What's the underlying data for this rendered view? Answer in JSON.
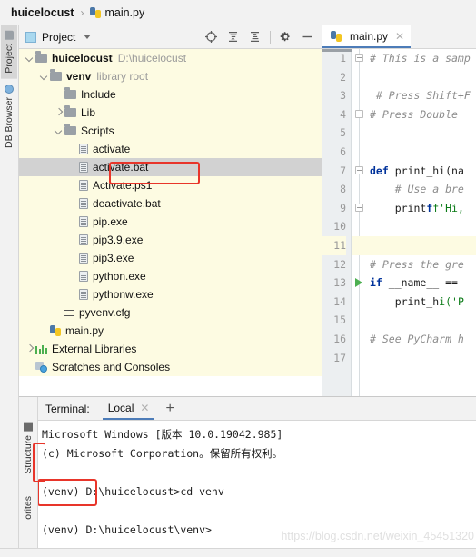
{
  "breadcrumb": {
    "project": "huicelocust",
    "separator": "›",
    "file": "main.py",
    "file_icon": "python-file-icon"
  },
  "left_strip": {
    "tabs": [
      {
        "label": "Project",
        "icon": "folder-icon",
        "active": true
      },
      {
        "label": "DB Browser",
        "icon": "database-icon",
        "active": false
      }
    ]
  },
  "bottom_strip": {
    "tabs": [
      {
        "label": "Structure",
        "icon": "structure-icon"
      },
      {
        "label": "orites",
        "icon": "favorites-icon"
      }
    ]
  },
  "project_panel": {
    "title": "Project",
    "title_icon": "project-panel-icon",
    "dropdown_icon": "chevron-down-icon",
    "toolbar": [
      {
        "name": "select-opened-file-icon"
      },
      {
        "name": "expand-all-icon"
      },
      {
        "name": "collapse-all-icon"
      },
      {
        "name": "settings-gear-icon"
      },
      {
        "name": "hide-panel-icon"
      }
    ],
    "tree": [
      {
        "label": "huicelocust",
        "suffix": "D:\\huicelocust",
        "indent": 0,
        "arrow": "down",
        "icon": "folder-icon",
        "bold": true,
        "selected": false
      },
      {
        "label": "venv",
        "suffix": "library root",
        "indent": 1,
        "arrow": "down",
        "icon": "folder-icon",
        "bold": true,
        "selected": false
      },
      {
        "label": "Include",
        "suffix": "",
        "indent": 2,
        "arrow": "none",
        "icon": "folder-icon",
        "bold": false,
        "selected": false
      },
      {
        "label": "Lib",
        "suffix": "",
        "indent": 2,
        "arrow": "right",
        "icon": "folder-icon",
        "bold": false,
        "selected": false
      },
      {
        "label": "Scripts",
        "suffix": "",
        "indent": 2,
        "arrow": "down",
        "icon": "folder-icon",
        "bold": false,
        "selected": false
      },
      {
        "label": "activate",
        "suffix": "",
        "indent": 3,
        "arrow": "none",
        "icon": "file-icon",
        "bold": false,
        "selected": false
      },
      {
        "label": "activate.bat",
        "suffix": "",
        "indent": 3,
        "arrow": "none",
        "icon": "file-icon",
        "bold": false,
        "selected": true
      },
      {
        "label": "Activate.ps1",
        "suffix": "",
        "indent": 3,
        "arrow": "none",
        "icon": "file-icon",
        "bold": false,
        "selected": false
      },
      {
        "label": "deactivate.bat",
        "suffix": "",
        "indent": 3,
        "arrow": "none",
        "icon": "file-icon",
        "bold": false,
        "selected": false
      },
      {
        "label": "pip.exe",
        "suffix": "",
        "indent": 3,
        "arrow": "none",
        "icon": "file-icon",
        "bold": false,
        "selected": false
      },
      {
        "label": "pip3.9.exe",
        "suffix": "",
        "indent": 3,
        "arrow": "none",
        "icon": "file-icon",
        "bold": false,
        "selected": false
      },
      {
        "label": "pip3.exe",
        "suffix": "",
        "indent": 3,
        "arrow": "none",
        "icon": "file-icon",
        "bold": false,
        "selected": false
      },
      {
        "label": "python.exe",
        "suffix": "",
        "indent": 3,
        "arrow": "none",
        "icon": "file-icon",
        "bold": false,
        "selected": false
      },
      {
        "label": "pythonw.exe",
        "suffix": "",
        "indent": 3,
        "arrow": "none",
        "icon": "file-icon",
        "bold": false,
        "selected": false
      },
      {
        "label": "pyvenv.cfg",
        "suffix": "",
        "indent": 2,
        "arrow": "none",
        "icon": "config-file-icon",
        "bold": false,
        "selected": false
      },
      {
        "label": "main.py",
        "suffix": "",
        "indent": 1,
        "arrow": "none",
        "icon": "python-file-icon",
        "bold": false,
        "selected": false
      },
      {
        "label": "External Libraries",
        "suffix": "",
        "indent": 0,
        "arrow": "right",
        "icon": "libraries-icon",
        "bold": false,
        "selected": false
      },
      {
        "label": "Scratches and Consoles",
        "suffix": "",
        "indent": 0,
        "arrow": "none",
        "icon": "scratches-icon",
        "bold": false,
        "selected": false
      }
    ]
  },
  "editor": {
    "tab": {
      "label": "main.py",
      "icon": "python-file-icon",
      "close_icon": "close-icon"
    },
    "lines": [
      {
        "n": "1",
        "text": "# This is a samp",
        "style": "cmt",
        "fold": "minus",
        "run": false,
        "hl": false
      },
      {
        "n": "2",
        "text": "",
        "style": "",
        "fold": "",
        "run": false,
        "hl": false
      },
      {
        "n": "3",
        "text": " # Press Shift+F",
        "style": "cmt",
        "fold": "",
        "run": false,
        "hl": false
      },
      {
        "n": "4",
        "text": "# Press Double ",
        "style": "cmt",
        "fold": "minus",
        "run": false,
        "hl": false
      },
      {
        "n": "5",
        "text": "",
        "style": "",
        "fold": "",
        "run": false,
        "hl": false
      },
      {
        "n": "6",
        "text": "",
        "style": "",
        "fold": "",
        "run": false,
        "hl": false
      },
      {
        "n": "7",
        "text": "def print_hi(na",
        "style": "def",
        "fold": "minus",
        "run": false,
        "hl": false
      },
      {
        "n": "8",
        "text": "    # Use a bre",
        "style": "cmt",
        "fold": "",
        "run": false,
        "hl": false
      },
      {
        "n": "9",
        "text": "    print(f'Hi,",
        "style": "prt",
        "fold": "minus",
        "run": false,
        "hl": false
      },
      {
        "n": "10",
        "text": "",
        "style": "",
        "fold": "",
        "run": false,
        "hl": false
      },
      {
        "n": "11",
        "text": "",
        "style": "",
        "fold": "",
        "run": false,
        "hl": true
      },
      {
        "n": "12",
        "text": "# Press the gre",
        "style": "cmt",
        "fold": "",
        "run": false,
        "hl": false
      },
      {
        "n": "13",
        "text": "if __name__ == ",
        "style": "ifl",
        "fold": "",
        "run": true,
        "hl": false
      },
      {
        "n": "14",
        "text": "    print_hi('P",
        "style": "prt2",
        "fold": "",
        "run": false,
        "hl": false
      },
      {
        "n": "15",
        "text": "",
        "style": "",
        "fold": "",
        "run": false,
        "hl": false
      },
      {
        "n": "16",
        "text": "# See PyCharm h",
        "style": "cmt",
        "fold": "",
        "run": false,
        "hl": false
      },
      {
        "n": "17",
        "text": "",
        "style": "",
        "fold": "",
        "run": false,
        "hl": false
      }
    ]
  },
  "terminal": {
    "label": "Terminal:",
    "tab": "Local",
    "close_icon": "close-icon",
    "add_icon": "add-tab-icon",
    "lines": [
      "Microsoft Windows [版本 10.0.19042.985]",
      "(c) Microsoft Corporation。保留所有权利。",
      "",
      "(venv) D:\\huicelocust>cd venv",
      "",
      "(venv) D:\\huicelocust\\venv>"
    ],
    "watermark": "https://blog.csdn.net/weixin_45451320"
  },
  "annotations": {
    "highlight_color": "#e8352a",
    "boxes": [
      {
        "name": "activate-bat-highlight"
      },
      {
        "name": "venv-prompt-highlight"
      },
      {
        "name": "structure-tab-highlight"
      }
    ]
  }
}
